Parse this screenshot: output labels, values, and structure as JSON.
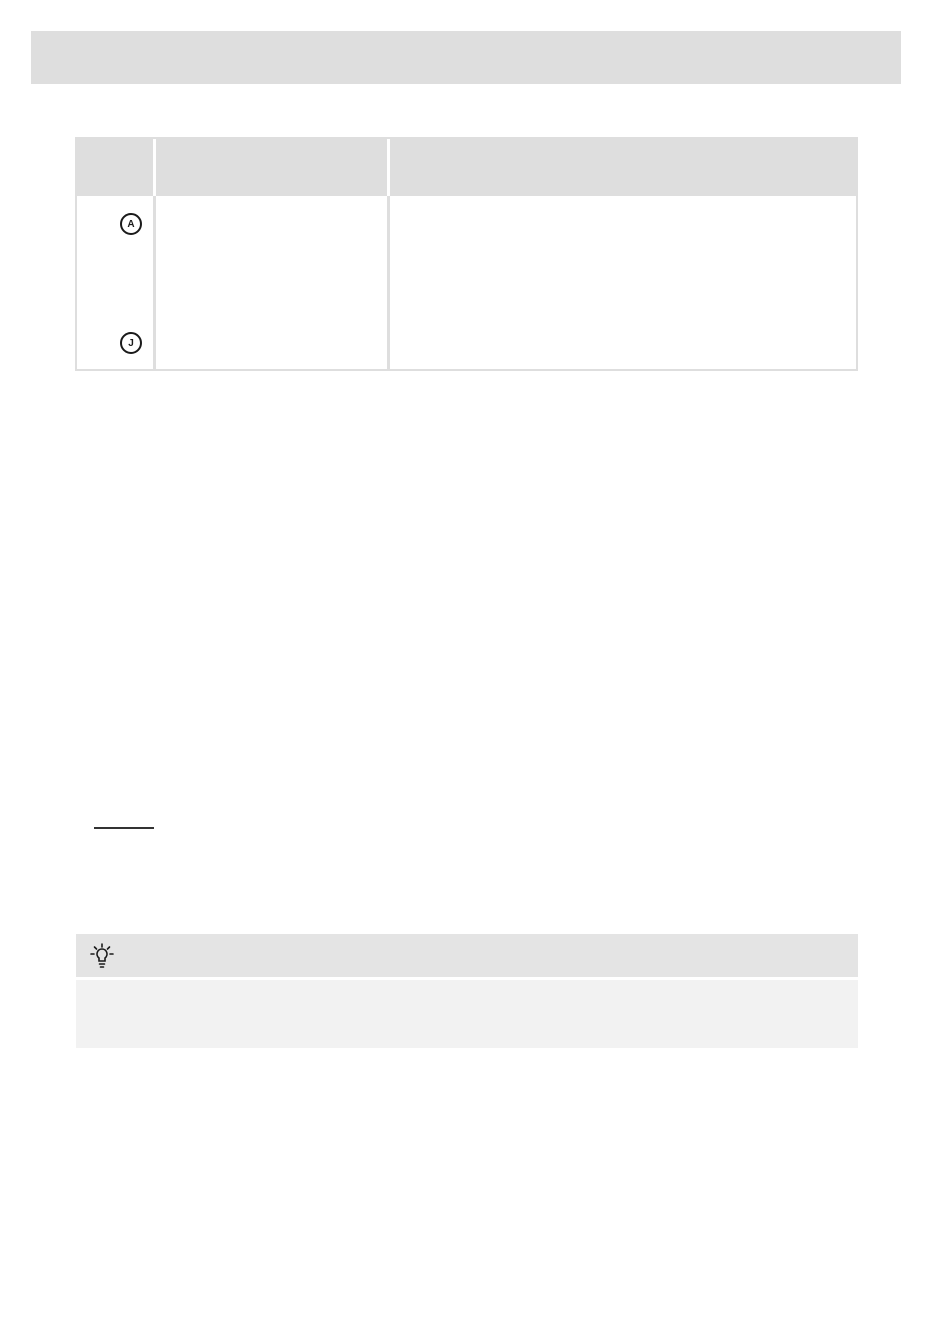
{
  "table": {
    "markers": [
      "A",
      "J"
    ]
  },
  "icons": {
    "tip": "lightbulb-icon"
  }
}
